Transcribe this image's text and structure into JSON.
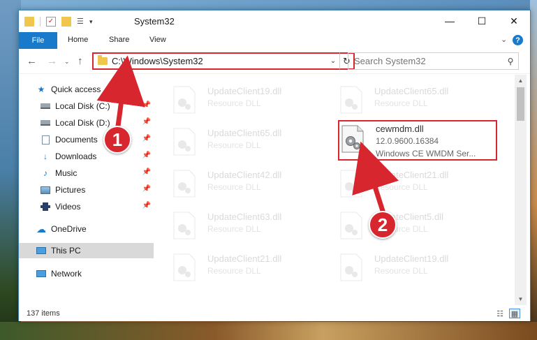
{
  "window": {
    "title": "System32",
    "controls": {
      "minimize": "—",
      "maximize": "☐",
      "close": "✕"
    }
  },
  "ribbon": {
    "tabs": [
      "File",
      "Home",
      "Share",
      "View"
    ],
    "help": "?"
  },
  "address": {
    "path": "C:\\Windows\\System32",
    "search_placeholder": "Search System32"
  },
  "nav": {
    "items": [
      {
        "label": "Quick access",
        "icon": "star-icon",
        "pinned": false
      },
      {
        "label": "Local Disk (C:)",
        "icon": "drive-icon",
        "pinned": true
      },
      {
        "label": "Local Disk (D:)",
        "icon": "drive-icon",
        "pinned": true
      },
      {
        "label": "Documents",
        "icon": "documents-icon",
        "pinned": true
      },
      {
        "label": "Downloads",
        "icon": "download-icon",
        "pinned": true
      },
      {
        "label": "Music",
        "icon": "music-icon",
        "pinned": true
      },
      {
        "label": "Pictures",
        "icon": "pictures-icon",
        "pinned": true
      },
      {
        "label": "Videos",
        "icon": "videos-icon",
        "pinned": true
      },
      {
        "label": "OneDrive",
        "icon": "cloud-icon",
        "pinned": false
      },
      {
        "label": "This PC",
        "icon": "computer-icon",
        "pinned": false,
        "selected": true
      },
      {
        "label": "Network",
        "icon": "network-icon",
        "pinned": false
      }
    ]
  },
  "files": {
    "left": [
      {
        "name": "UpdateClient19.dll",
        "type": "Resource DLL"
      },
      {
        "name": "UpdateClient65.dll",
        "type": "Resource DLL"
      },
      {
        "name": "UpdateClient42.dll",
        "type": "Resource DLL"
      },
      {
        "name": "UpdateClient63.dll",
        "type": "Resource DLL"
      },
      {
        "name": "UpdateClient21.dll",
        "type": "Resource DLL"
      }
    ],
    "right": [
      {
        "name": "UpdateClient65.dll",
        "type": "Resource DLL"
      },
      {
        "name": "UpdateClient21.dll",
        "type": "Resource DLL"
      },
      {
        "name": "UpdateClient5.dll",
        "type": "Resource DLL"
      },
      {
        "name": "UpdateClient19.dll",
        "type": "Resource DLL"
      }
    ],
    "highlighted": {
      "name": "cewmdm.dll",
      "version": "12.0.9600.16384",
      "description": "Windows CE WMDM Ser..."
    }
  },
  "status": {
    "item_count": "137 items"
  },
  "annotations": {
    "step1": "1",
    "step2": "2",
    "color": "#d8262e"
  }
}
